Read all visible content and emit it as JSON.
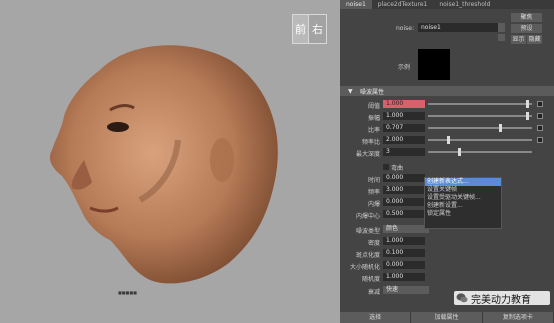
{
  "viewport": {
    "viewcube": {
      "front": "前",
      "right": "右"
    },
    "label": "■■■■■"
  },
  "panel": {
    "tabs": [
      "noise1",
      "place2dTexture1",
      "noise1_threshold"
    ],
    "side_buttons": {
      "focus": "聚焦",
      "presets": "预设",
      "show": "显示",
      "hide": "隐藏"
    },
    "node": {
      "label": "noise:",
      "value": "noise1"
    },
    "sample_label": "示例",
    "section_title": "噪波属性",
    "attributes": [
      {
        "label": "阈值",
        "value": "1.000",
        "highlight": true,
        "slider_pos": 0.97,
        "map": true
      },
      {
        "label": "振幅",
        "value": "1.000",
        "slider_pos": 0.97,
        "map": true
      },
      {
        "label": "比率",
        "value": "0.707",
        "slider_pos": 0.7,
        "map": true
      },
      {
        "label": "频率比",
        "value": "2.000",
        "slider_pos": 0.19,
        "map": true
      },
      {
        "label": "最大深度",
        "value": "3",
        "slider_pos": 0.3,
        "map": false
      }
    ],
    "checkbox_label": "弯曲",
    "lower_attributes": [
      {
        "label": "时间",
        "value": "0.000"
      },
      {
        "label": "频率",
        "value": "3.000"
      },
      {
        "label": "内爆",
        "value": "0.000"
      },
      {
        "label": "内爆中心",
        "value": "0.500"
      }
    ],
    "noise_type": {
      "label": "噪波类型",
      "value": "颜色"
    },
    "bottom_attributes": [
      {
        "label": "密度",
        "value": "1.000"
      },
      {
        "label": "斑点化度",
        "value": "0.100"
      },
      {
        "label": "大小随机化",
        "value": "0.000"
      },
      {
        "label": "随机度",
        "value": "1.000"
      }
    ],
    "falloff": {
      "label": "衰减",
      "value": "快速"
    },
    "context_menu": [
      "创建新表达式...",
      "设置关键帧",
      "设置受驱动关键帧...",
      "创建新设置...",
      "锁定属性"
    ],
    "bottom_buttons": [
      "选择",
      "加载属性",
      "复制选项卡"
    ]
  },
  "watermark": {
    "text": "完美动力教育"
  }
}
